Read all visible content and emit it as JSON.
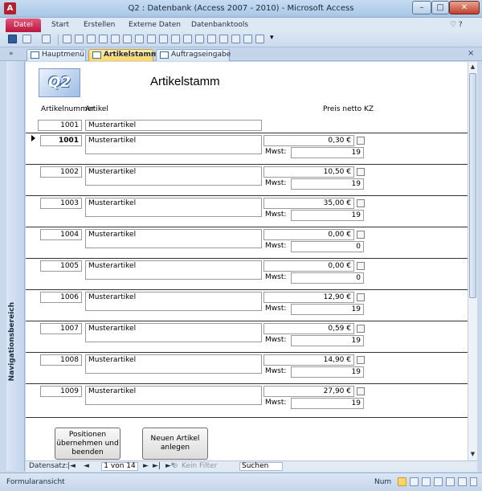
{
  "window": {
    "title": "Q2 : Datenbank (Access 2007 - 2010) - Microsoft Access",
    "app_icon": "A"
  },
  "window_controls": {
    "minimize": "–",
    "maximize": "□",
    "close": "✕"
  },
  "ribbon": {
    "tabs": [
      "Datei",
      "Start",
      "Erstellen",
      "Externe Daten",
      "Datenbanktools"
    ],
    "help_icons": "♡ ?"
  },
  "nav_toggle": "»",
  "doc_tabs": [
    "Hauptmenü",
    "Artikelstamm",
    "Auftragseingabe"
  ],
  "doc_close": "×",
  "nav_pane_label": "Navigationsbereich",
  "form": {
    "logo_text": "Q2",
    "title": "Artikelstamm",
    "headers": {
      "number": "Artikelnummer",
      "article": "Artikel",
      "price": "Preis netto KZ"
    },
    "filter_row": {
      "number": "1001",
      "article": "Musterartikel"
    },
    "mwst_label": "Mwst:",
    "records": [
      {
        "number": "1001",
        "article": "Musterartikel",
        "price": "0,30 €",
        "mwst": "19"
      },
      {
        "number": "1002",
        "article": "Musterartikel",
        "price": "10,50 €",
        "mwst": "19"
      },
      {
        "number": "1003",
        "article": "Musterartikel",
        "price": "35,00 €",
        "mwst": "19"
      },
      {
        "number": "1004",
        "article": "Musterartikel",
        "price": "0,00 €",
        "mwst": "0"
      },
      {
        "number": "1005",
        "article": "Musterartikel",
        "price": "0,00 €",
        "mwst": "0"
      },
      {
        "number": "1006",
        "article": "Musterartikel",
        "price": "12,90 €",
        "mwst": "19"
      },
      {
        "number": "1007",
        "article": "Musterartikel",
        "price": "0,59 €",
        "mwst": "19"
      },
      {
        "number": "1008",
        "article": "Musterartikel",
        "price": "14,90 €",
        "mwst": "19"
      },
      {
        "number": "1009",
        "article": "Musterartikel",
        "price": "27,90 €",
        "mwst": "19"
      }
    ],
    "buttons": {
      "apply_line1": "Positionen",
      "apply_line2": "übernehmen und",
      "apply_line3": "beenden",
      "new_line1": "Neuen Artikel",
      "new_line2": "anlegen"
    }
  },
  "record_nav": {
    "label": "Datensatz:",
    "first": "|◄",
    "prev": "◄",
    "position": "1 von 14",
    "next": "►",
    "last": "►|",
    "new": "►*",
    "filter": "Kein Filter",
    "search": "Suchen"
  },
  "status": {
    "left": "Formularansicht",
    "num": "Num"
  }
}
